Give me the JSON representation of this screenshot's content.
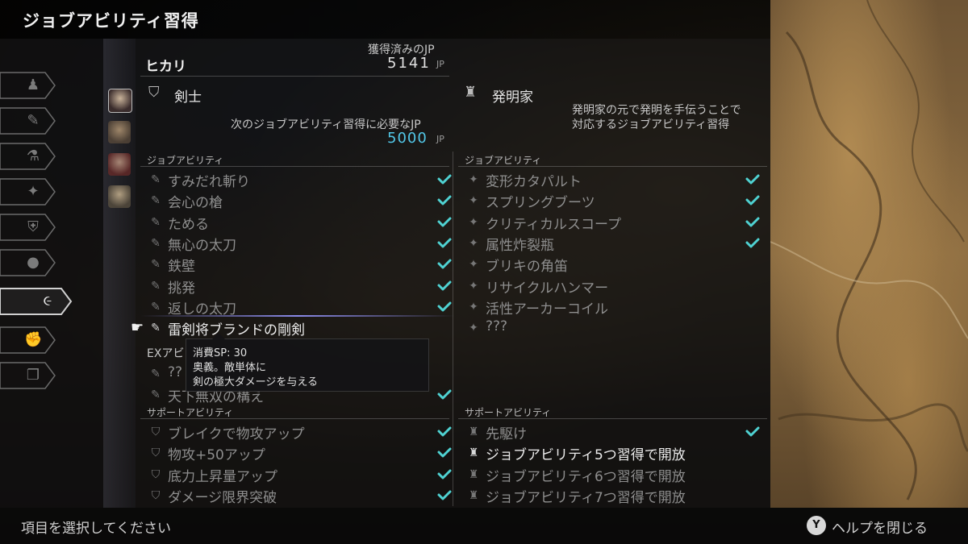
{
  "title": "ジョブアビリティ習得",
  "character_name": "ヒカリ",
  "jp": {
    "label": "獲得済みのJP",
    "value": "5141",
    "unit": "JP"
  },
  "left_job": {
    "name": "剣士",
    "next_label": "次のジョブアビリティ習得に必要なJP",
    "next_value": "5000",
    "next_unit": "JP",
    "job_section": "ジョブアビリティ",
    "abilities": [
      {
        "name": "すみだれ斬り",
        "learned": true
      },
      {
        "name": "会心の槍",
        "learned": true
      },
      {
        "name": "ためる",
        "learned": true
      },
      {
        "name": "無心の太刀",
        "learned": true
      },
      {
        "name": "鉄壁",
        "learned": true
      },
      {
        "name": "挑発",
        "learned": true
      },
      {
        "name": "返しの太刀",
        "learned": true
      },
      {
        "name": "雷剣将ブランドの剛剣",
        "learned": false,
        "selected": true
      }
    ],
    "ex_section": "EXアビ",
    "ex_abilities": [
      {
        "name": "??",
        "learned": false
      },
      {
        "name": "天下無双の構え",
        "learned": true
      }
    ],
    "support_section": "サポートアビリティ",
    "support": [
      {
        "name": "ブレイクで物攻アップ",
        "learned": true
      },
      {
        "name": "物攻+50アップ",
        "learned": true
      },
      {
        "name": "底力上昇量アップ",
        "learned": true
      },
      {
        "name": "ダメージ限界突破",
        "learned": true
      }
    ]
  },
  "right_job": {
    "name": "発明家",
    "desc_line1": "発明家の元で発明を手伝うことで",
    "desc_line2": "対応するジョブアビリティ習得",
    "job_section": "ジョブアビリティ",
    "abilities": [
      {
        "name": "変形カタパルト",
        "learned": true
      },
      {
        "name": "スプリングブーツ",
        "learned": true
      },
      {
        "name": "クリティカルスコープ",
        "learned": true
      },
      {
        "name": "属性炸裂瓶",
        "learned": true
      },
      {
        "name": "ブリキの角笛",
        "learned": false
      },
      {
        "name": "リサイクルハンマー",
        "learned": false
      },
      {
        "name": "活性アーカーコイル",
        "learned": false
      },
      {
        "name": "???",
        "learned": false
      }
    ],
    "support_section": "サポートアビリティ",
    "support": [
      {
        "name": "先駆け",
        "learned": true
      },
      {
        "name": "ジョブアビリティ5つ習得で開放",
        "learned": false,
        "bright": true
      },
      {
        "name": "ジョブアビリティ6つ習得で開放",
        "learned": false
      },
      {
        "name": "ジョブアビリティ7つ習得で開放",
        "learned": false
      }
    ]
  },
  "tooltip": {
    "line1": "消費SP: 30",
    "line2": "奥義。敵単体に",
    "line3": "剣の極大ダメージを与える"
  },
  "footer": {
    "hint": "項目を選択してください",
    "button": "Y",
    "help": "ヘルプを閉じる"
  },
  "colors": {
    "check": "#4fd2d2",
    "jp_required": "#52c8e8"
  }
}
